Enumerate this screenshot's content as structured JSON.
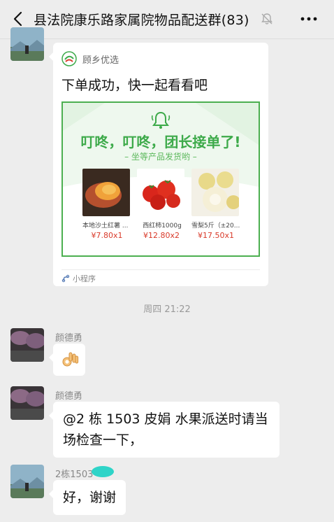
{
  "header": {
    "title": "县法院康乐路家属院物品配送群(83)",
    "back_icon": "back-chevron-icon",
    "mute_icon": "bell-muted-icon",
    "more_icon": "more-dots-icon"
  },
  "messages": [
    {
      "type": "mini-program-card",
      "source_name": "顾乡优选",
      "text": "下单成功，快一起看看吧",
      "banner": {
        "headline": "叮咚，叮咚，团长接单了!",
        "subline": "– 坐等产品发货哟 –",
        "products": [
          {
            "name": "本地沙土红薯 ...",
            "price": "¥7.80x1"
          },
          {
            "name": "西红柿1000g",
            "price": "¥12.80x2"
          },
          {
            "name": "雪梨5斤（±20...",
            "price": "¥17.50x1"
          }
        ]
      },
      "footer": "小程序"
    },
    {
      "type": "timestamp",
      "text": "周四 21:22"
    },
    {
      "type": "emoji",
      "sender": "颜德勇",
      "emoji": "ok-hand"
    },
    {
      "type": "text",
      "sender": "颜德勇",
      "line1": "@2 栋 1503 皮娟  水果派送时请当",
      "line2": "场检查一下，"
    },
    {
      "type": "text",
      "sender": "2栋1503",
      "text": "好，谢谢"
    }
  ],
  "colors": {
    "background": "#ededed",
    "banner_green": "#3daa4a",
    "price_red": "#d93a2a"
  }
}
